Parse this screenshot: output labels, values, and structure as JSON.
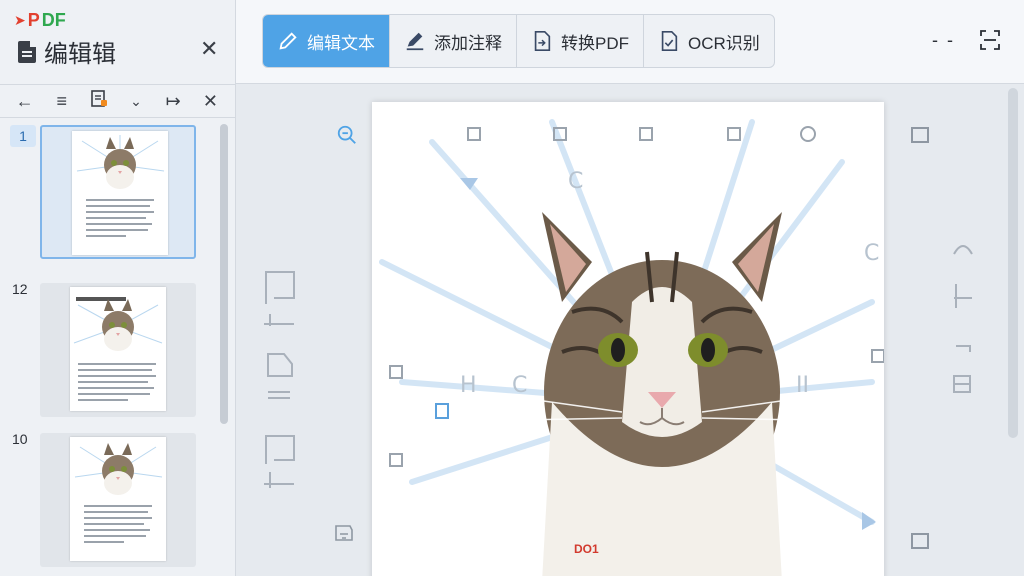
{
  "app": {
    "brand_arrow": "➤",
    "brand_p": "P",
    "brand_df": "DF",
    "doc_title": "编辑辑"
  },
  "left_toolbar": {
    "back": "←",
    "menu": "≡",
    "chevron": "⌄",
    "export": "↦",
    "close": "✕"
  },
  "thumbnails": [
    {
      "page": "1"
    },
    {
      "page": "12"
    },
    {
      "page": "10"
    }
  ],
  "toolbar": {
    "tools": [
      {
        "label": "编辑文本",
        "icon": "pen-icon",
        "active": true
      },
      {
        "label": "添加注释",
        "icon": "annotate-icon",
        "active": false
      },
      {
        "label": "转换PDF",
        "icon": "convert-pdf-icon",
        "active": false
      },
      {
        "label": "OCR识别",
        "icon": "ocr-icon",
        "active": false
      }
    ],
    "more": "- -"
  },
  "page": {
    "footer_code": "DO1"
  },
  "colors": {
    "accent": "#4fa3e6",
    "brand_red": "#e2402f",
    "brand_green": "#2fa84f"
  }
}
